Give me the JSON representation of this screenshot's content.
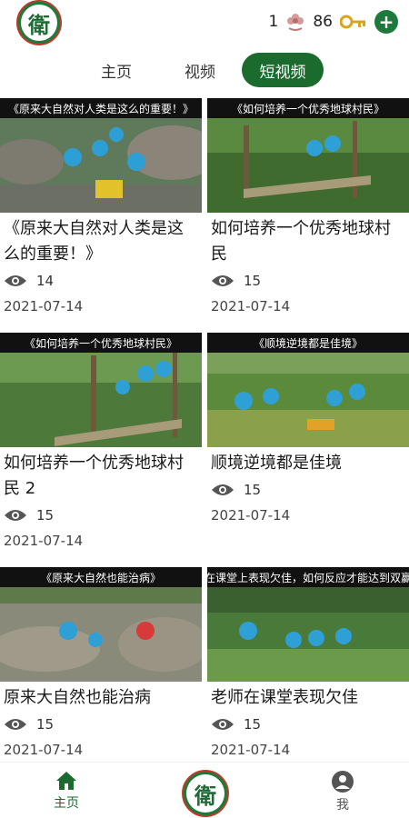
{
  "header": {
    "logo_text": "衛",
    "count_a": "1",
    "count_b": "86",
    "icons": [
      "flower-icon",
      "key-icon",
      "plus-icon"
    ]
  },
  "tabs": [
    {
      "label": "主页",
      "active": false
    },
    {
      "label": "视频",
      "active": false
    },
    {
      "label": "短视频",
      "active": true
    }
  ],
  "videos": [
    {
      "caption": "《原来大自然对人类是这么的重要！》",
      "title": "《原来大自然对人类是这么的重要！》",
      "views": "14",
      "date": "2021-07-14"
    },
    {
      "caption": "《如何培养一个优秀地球村民》",
      "title": "如何培养一个优秀地球村民",
      "views": "15",
      "date": "2021-07-14"
    },
    {
      "caption": "《如何培养一个优秀地球村民》",
      "title": "如何培养一个优秀地球村民 2",
      "views": "15",
      "date": "2021-07-14"
    },
    {
      "caption": "《顺境逆境都是佳境》",
      "title": "顺境逆境都是佳境",
      "views": "15",
      "date": "2021-07-14"
    },
    {
      "caption": "《原来大自然也能治病》",
      "title": "原来大自然也能治病",
      "views": "15",
      "date": "2021-07-14"
    },
    {
      "caption": "《老师在课堂上表现欠佳，如何反应才能达到双赢局面》",
      "title": "老师在课堂表现欠佳",
      "views": "15",
      "date": "2021-07-14"
    }
  ],
  "bottom_nav": {
    "home_label": "主页",
    "me_label": "我"
  },
  "colors": {
    "brand_green": "#1a6b2d",
    "logo_ring": "#c0392b"
  }
}
